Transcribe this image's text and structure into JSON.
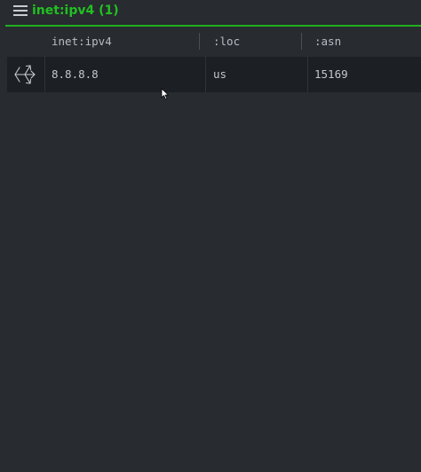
{
  "header": {
    "menu_icon": "hamburger-menu-icon",
    "title": "inet:ipv4 (1)",
    "accent_color": "#1fb11f"
  },
  "table": {
    "columns": [
      "inet:ipv4",
      ":loc",
      ":asn"
    ],
    "rows": [
      {
        "icon": "node-graph-icon",
        "ipv4": "8.8.8.8",
        "loc": "us",
        "asn": "15169"
      }
    ]
  }
}
